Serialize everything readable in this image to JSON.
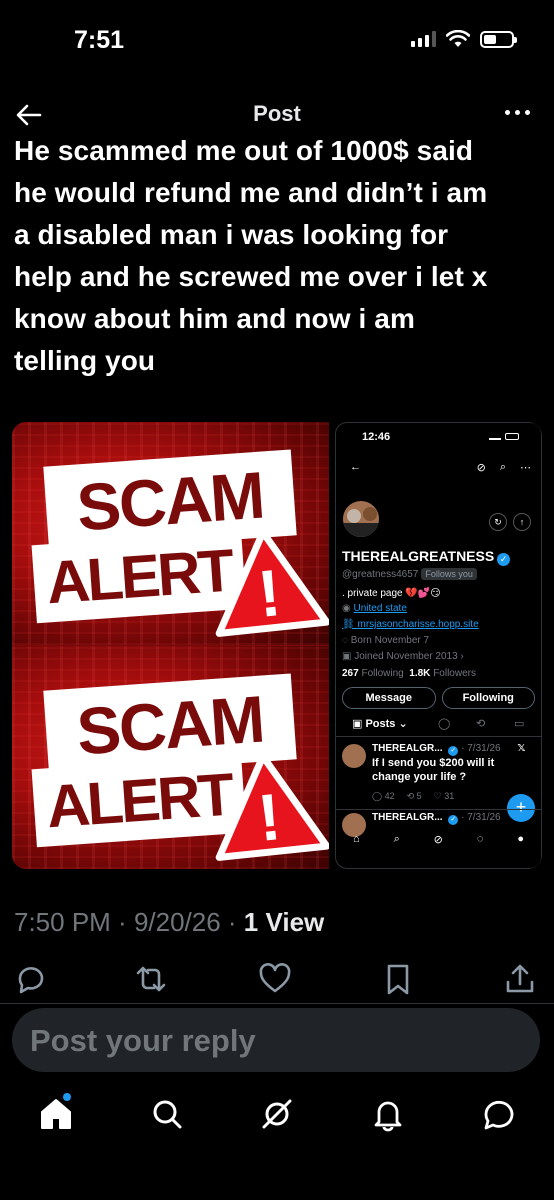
{
  "status_bar": {
    "time": "7:51"
  },
  "header": {
    "title": "Post"
  },
  "post": {
    "lines": [
      "He scammed me out of 1000$ said",
      "he would refund me and didn’t i am",
      "a disabled man i was looking for",
      "help and he screwed me over i let x",
      "know about him and now i am",
      "telling you"
    ],
    "meta_time": "7:50 PM",
    "meta_date": "9/20/26",
    "meta_views_count": "1",
    "meta_views_label": "View"
  },
  "media": {
    "scam_word": "SCAM",
    "alert_word": "ALERT",
    "exclamation": "!",
    "accent_red": "#c8101a",
    "profile_screenshot": {
      "time": "12:46",
      "name": "THEREALGREATNESS",
      "handle": "greatness4657",
      "follows_you": "Follows you",
      "bio": ". private page 💔💕😏",
      "location": "United state",
      "link": "mrsjasoncharisse.hopp.site",
      "born": "Born November 7",
      "joined": "Joined November 2013",
      "following_count": "267",
      "following_label": "Following",
      "followers_count": "1.8K",
      "followers_label": "Followers",
      "message_btn": "Message",
      "following_btn": "Following",
      "tab_posts": "Posts",
      "tweet1_name": "THEREALGR...",
      "tweet1_date": "7/31/26",
      "tweet1_text": "If I send you $200 will it change your life ?",
      "tweet1_replies": "42",
      "tweet1_reposts": "5",
      "tweet1_likes": "31",
      "tweet2_name": "THEREALGR...",
      "tweet2_date": "7/31/26"
    }
  },
  "reply": {
    "placeholder": "Post your reply"
  },
  "icons": {
    "back": "back-arrow-icon",
    "more": "more-icon",
    "reply": "reply-icon",
    "repost": "repost-icon",
    "like": "heart-icon",
    "bookmark": "bookmark-icon",
    "share": "share-icon",
    "home": "home-icon",
    "search": "search-icon",
    "grok": "grok-icon",
    "notifications": "bell-icon",
    "messages": "messages-icon"
  },
  "colors": {
    "accent": "#1d9bf0",
    "background": "#000000",
    "muted": "#71767b"
  }
}
